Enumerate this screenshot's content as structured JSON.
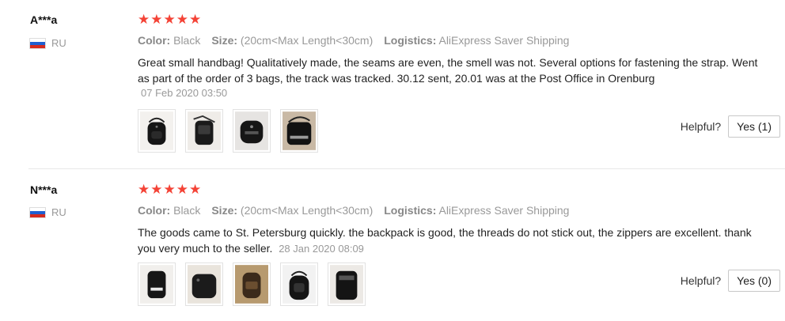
{
  "reviews": [
    {
      "user": "A***a",
      "country": "RU",
      "stars": "★★★★★",
      "color_label": "Color:",
      "color_value": "Black",
      "size_label": "Size:",
      "size_value": "(20cm<Max Length<30cm)",
      "logistics_label": "Logistics:",
      "logistics_value": "AliExpress Saver Shipping",
      "text": "Great small handbag! Qualitatively made, the seams are even, the smell was not. Several options for fastening the strap. Went as part of the order of 3 bags, the track was tracked. 30.12 sent, 20.01 was at the Post Office in Orenburg",
      "date": "07 Feb 2020 03:50",
      "helpful_label": "Helpful?",
      "yes_label": "Yes (1)"
    },
    {
      "user": "N***a",
      "country": "RU",
      "stars": "★★★★★",
      "color_label": "Color:",
      "color_value": "Black",
      "size_label": "Size:",
      "size_value": "(20cm<Max Length<30cm)",
      "logistics_label": "Logistics:",
      "logistics_value": "AliExpress Saver Shipping",
      "text": "The goods came to St. Petersburg quickly. the backpack is good, the threads do not stick out, the zippers are excellent. thank you very much to the seller.",
      "date": "28 Jan 2020 08:09",
      "helpful_label": "Helpful?",
      "yes_label": "Yes (0)"
    }
  ],
  "colors": {
    "star": "#f44336",
    "muted": "#999999",
    "divider": "#e8e8e8"
  }
}
